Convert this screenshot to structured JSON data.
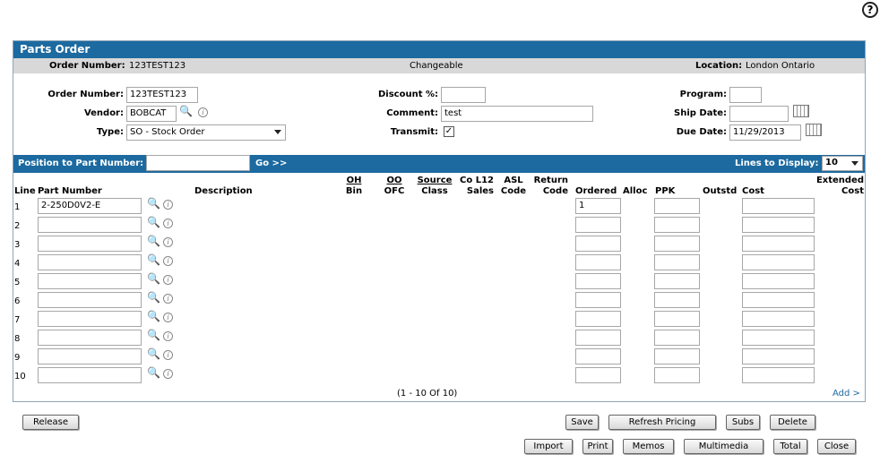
{
  "help_glyph": "?",
  "title": "Parts Order",
  "info": {
    "order_number_label": "Order Number:",
    "order_number": "123TEST123",
    "status": "Changeable",
    "location_label": "Location:",
    "location": "London Ontario"
  },
  "form": {
    "order_number_label": "Order Number:",
    "order_number": "123TEST123",
    "vendor_label": "Vendor:",
    "vendor": "BOBCAT",
    "type_label": "Type:",
    "type": "SO - Stock Order",
    "discount_label": "Discount %:",
    "discount": "",
    "comment_label": "Comment:",
    "comment": "test",
    "transmit_label": "Transmit:",
    "transmit_checked": true,
    "transmit_glyph": "✓",
    "program_label": "Program:",
    "program": "",
    "ship_date_label": "Ship Date:",
    "ship_date": "",
    "due_date_label": "Due Date:",
    "due_date": "11/29/2013"
  },
  "position_bar": {
    "label": "Position to Part Number:",
    "value": "",
    "go": "Go >>",
    "lines_label": "Lines to Display:",
    "lines_value": "10"
  },
  "columns": {
    "line": "Line",
    "part_number": "Part Number",
    "description": "Description",
    "oh": "OH",
    "bin": "Bin",
    "oo": "OO",
    "ofc": "OFC",
    "source": "Source",
    "class": "Class",
    "col12": "Co L12",
    "sales": "Sales",
    "asl": "ASL",
    "code": "Code",
    "return": "Return",
    "return_code": "Code",
    "ordered": "Ordered",
    "alloc": "Alloc",
    "ppk": "PPK",
    "outstd": "Outstd",
    "cost": "Cost",
    "extended": "Extended",
    "ext_cost": "Cost"
  },
  "rows": [
    {
      "line": "1",
      "part": "2-250D0V2-E",
      "ordered": "1",
      "ppk": "",
      "cost": ""
    },
    {
      "line": "2",
      "part": "",
      "ordered": "",
      "ppk": "",
      "cost": ""
    },
    {
      "line": "3",
      "part": "",
      "ordered": "",
      "ppk": "",
      "cost": ""
    },
    {
      "line": "4",
      "part": "",
      "ordered": "",
      "ppk": "",
      "cost": ""
    },
    {
      "line": "5",
      "part": "",
      "ordered": "",
      "ppk": "",
      "cost": ""
    },
    {
      "line": "6",
      "part": "",
      "ordered": "",
      "ppk": "",
      "cost": ""
    },
    {
      "line": "7",
      "part": "",
      "ordered": "",
      "ppk": "",
      "cost": ""
    },
    {
      "line": "8",
      "part": "",
      "ordered": "",
      "ppk": "",
      "cost": ""
    },
    {
      "line": "9",
      "part": "",
      "ordered": "",
      "ppk": "",
      "cost": ""
    },
    {
      "line": "10",
      "part": "",
      "ordered": "",
      "ppk": "",
      "cost": ""
    }
  ],
  "icons": {
    "lookup": "magnifier-icon",
    "info": "info-icon",
    "calendar": "calendar-icon",
    "help": "help-icon"
  },
  "lookup_glyph": "🔍",
  "info_glyph": "i",
  "pager": "(1 - 10 Of 10)",
  "add_link": "Add >",
  "buttons": {
    "release": "Release",
    "save": "Save",
    "refresh_pricing": "Refresh Pricing",
    "subs": "Subs",
    "delete": "Delete",
    "import": "Import",
    "print": "Print",
    "memos": "Memos",
    "multimedia": "Multimedia",
    "total": "Total",
    "close": "Close"
  },
  "colors": {
    "header_blue": "#1c6aa0",
    "info_gray": "#d8d8d8",
    "link_blue": "#1c6aa0"
  }
}
